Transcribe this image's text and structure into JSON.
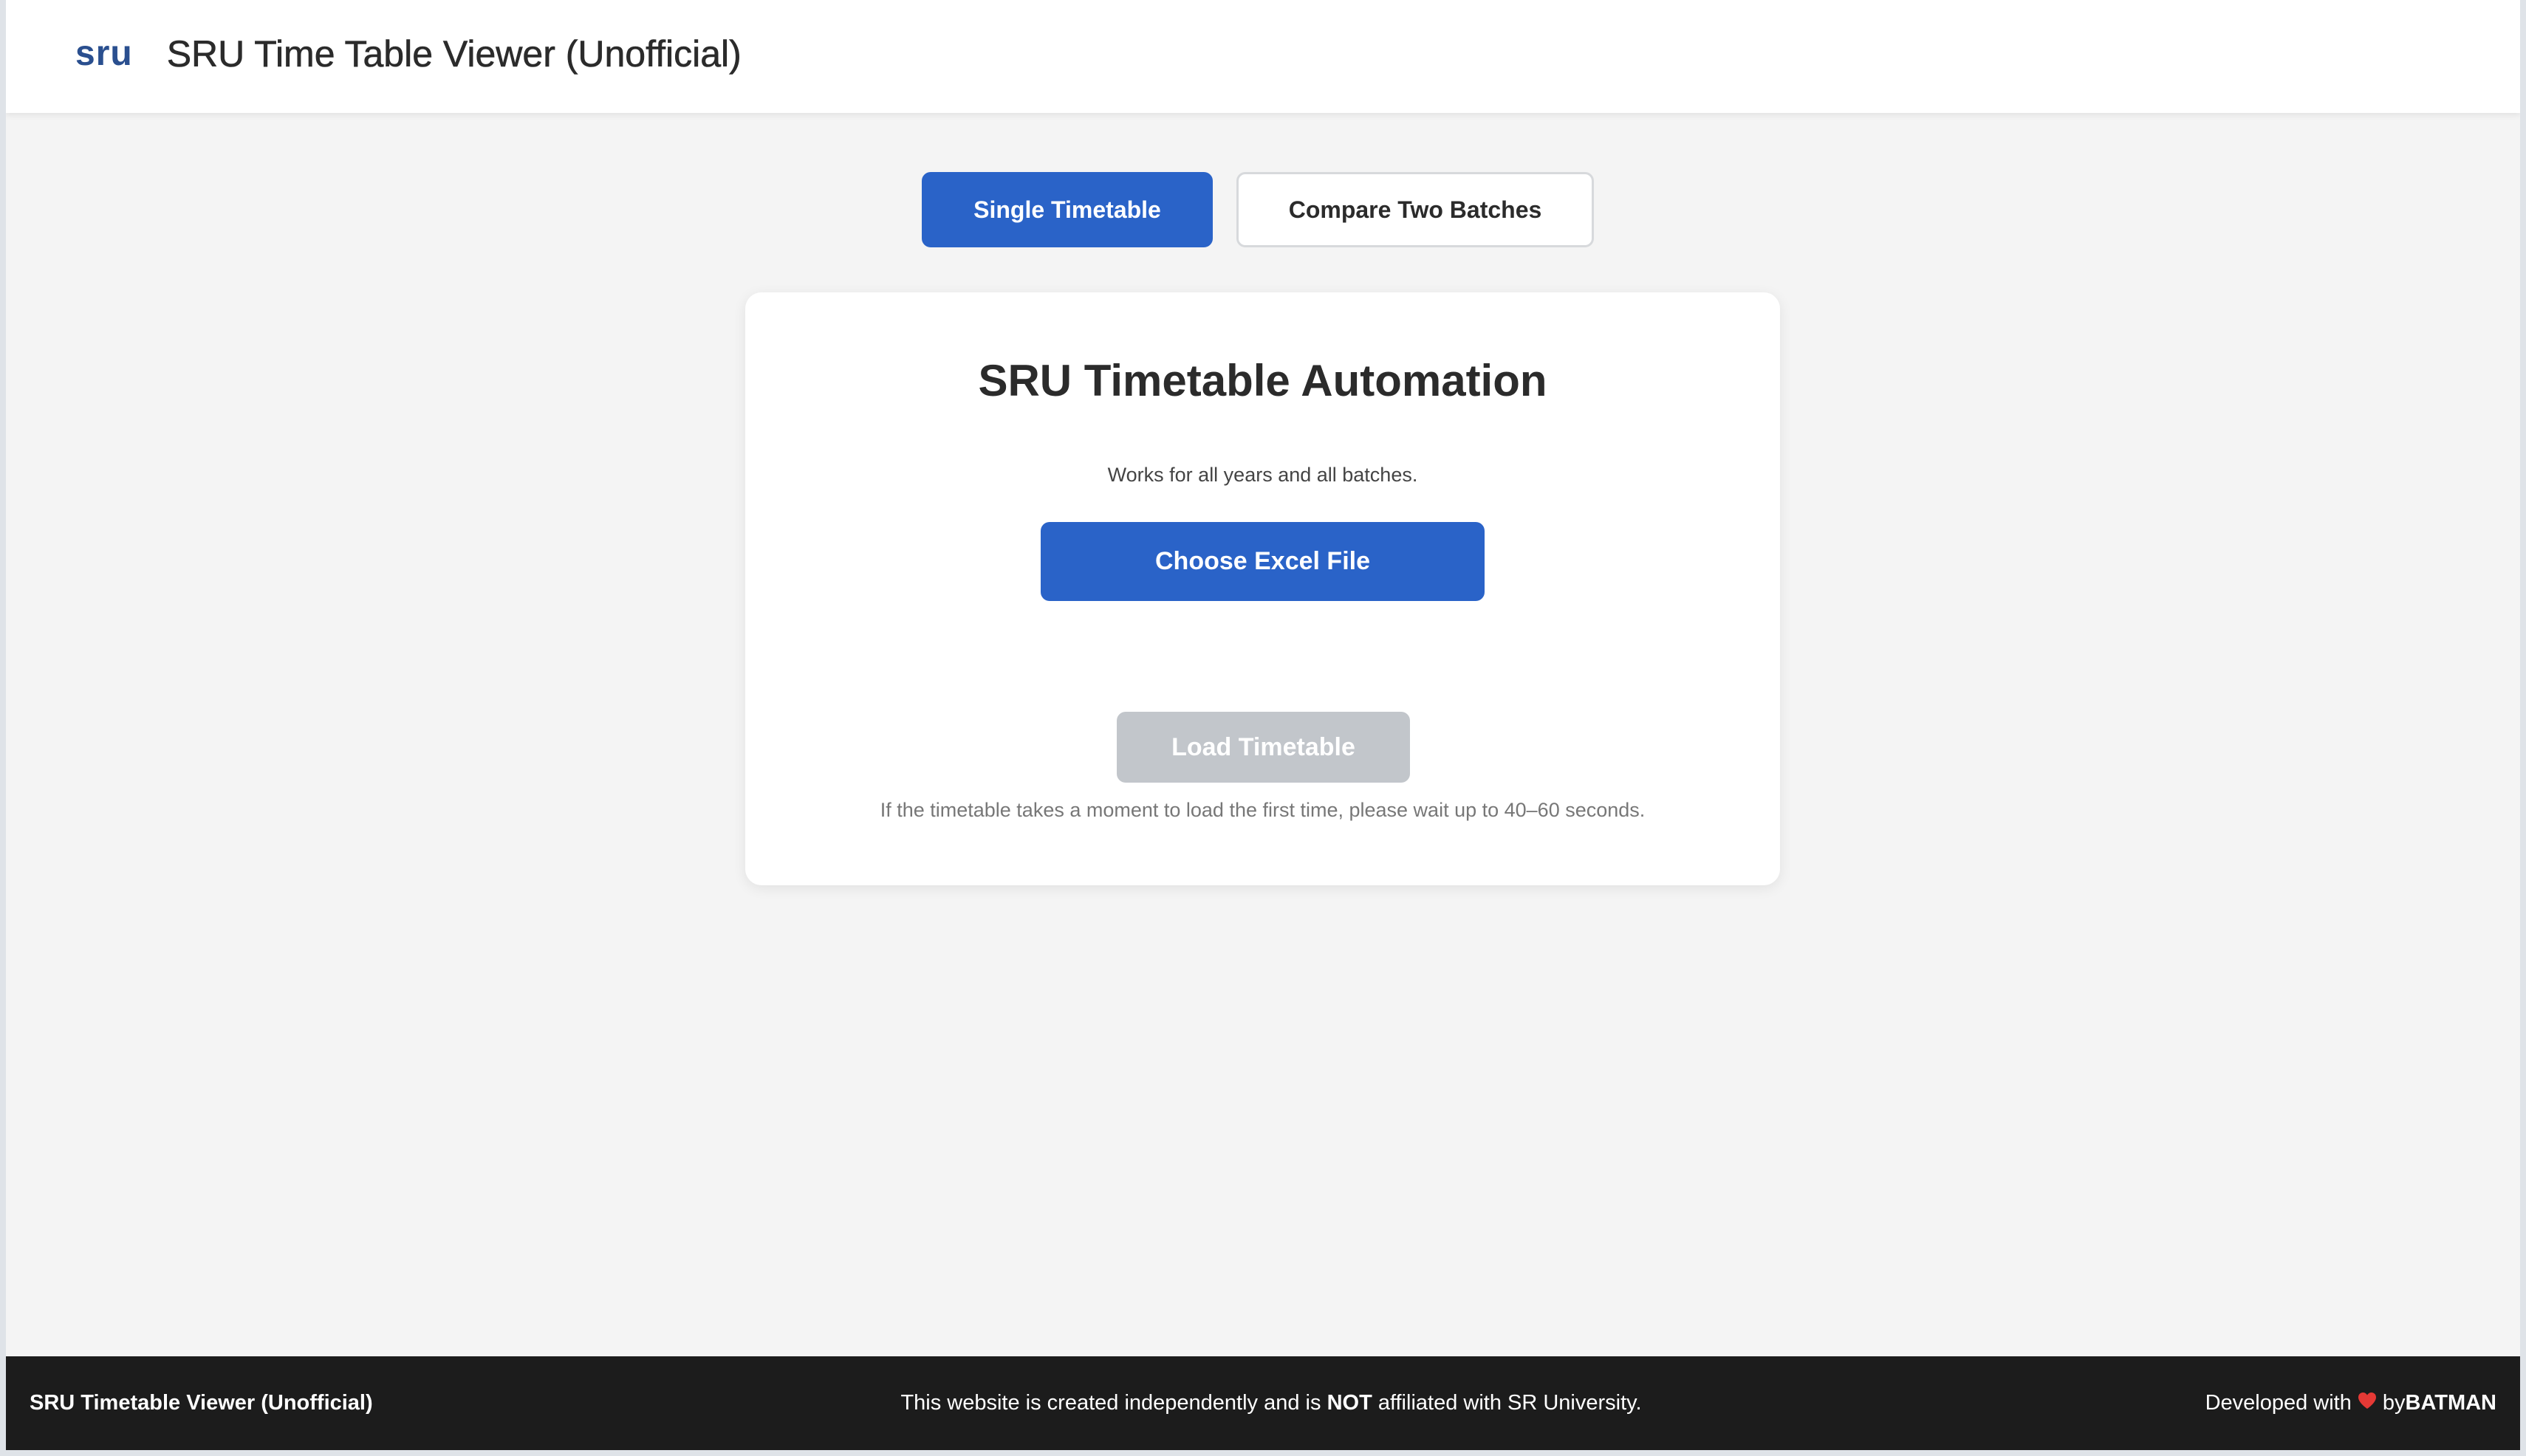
{
  "header": {
    "logo_text": "sru",
    "title": "SRU Time Table Viewer (Unofficial)"
  },
  "mode_tabs": [
    {
      "label": "Single Timetable",
      "active": true
    },
    {
      "label": "Compare Two Batches",
      "active": false
    }
  ],
  "card": {
    "title": "SRU Timetable Automation",
    "subtitle": "Works for all years and all batches.",
    "choose_button_label": "Choose Excel File",
    "load_button_label": "Load Timetable",
    "note": "If the timetable takes a moment to load the first time, please wait up to 40–60 seconds."
  },
  "footer": {
    "left_text": "SRU Timetable Viewer (Unofficial)",
    "disclaimer_before": "This website is created independently and is ",
    "disclaimer_bold": "NOT",
    "disclaimer_after": " affiliated with SR University.",
    "credit_before": "Developed with",
    "credit_icon": "heart-icon",
    "credit_middle": "by ",
    "credit_bold": "BATMAN"
  },
  "colors": {
    "primary": "#2a63c8",
    "brand": "#2a4f8f",
    "disabled_button": "#c2c6cb",
    "footer_bg": "#1c1c1c",
    "page_bg": "#f4f4f4",
    "heart": "#e53935"
  }
}
